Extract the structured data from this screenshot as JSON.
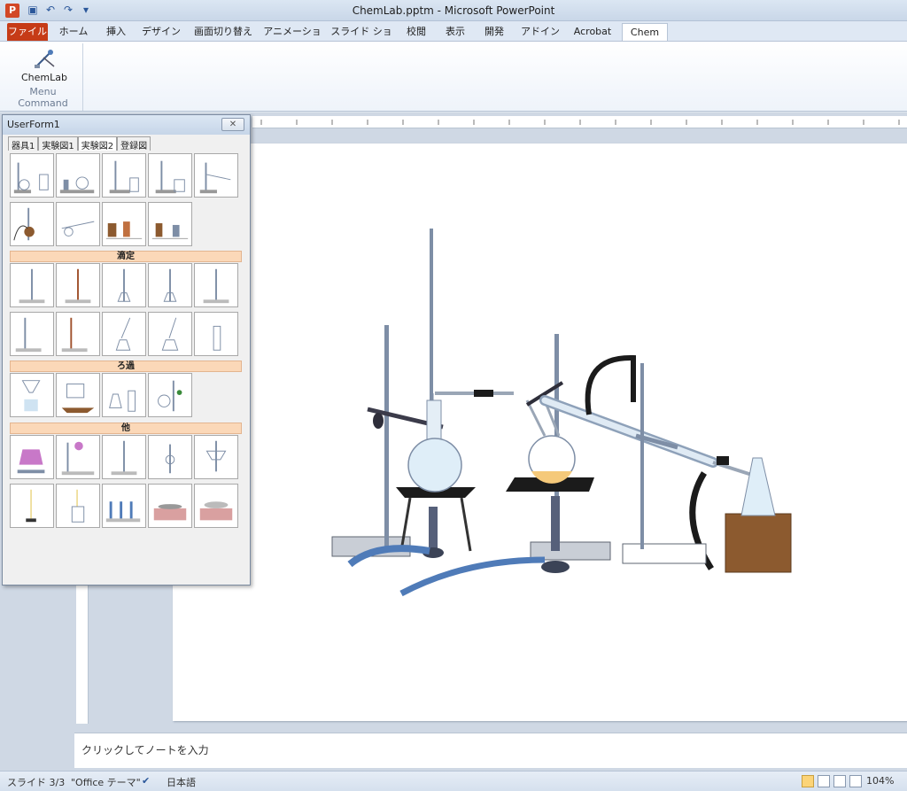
{
  "window": {
    "title": "ChemLab.pptm - Microsoft PowerPoint",
    "app_icon": "P"
  },
  "ribbon": {
    "tabs": [
      "ファイル",
      "ホーム",
      "挿入",
      "デザイン",
      "画面切り替え",
      "アニメーション",
      "スライド ショー",
      "校閲",
      "表示",
      "開発",
      "アドイン",
      "Acrobat",
      "Chem"
    ],
    "active_tab": "Chem",
    "group": {
      "button_label": "ChemLab",
      "group_label": "Menu Command"
    }
  },
  "userform": {
    "title": "UserForm1",
    "close": "✕",
    "tabs": [
      "器具1",
      "実験図1",
      "実験図2",
      "登録図"
    ],
    "active_tab": "実験図2",
    "sections": [
      "滴定",
      "ろ過",
      "他"
    ]
  },
  "notes": {
    "placeholder": "クリックしてノートを入力"
  },
  "statusbar": {
    "slide": "スライド 3/3",
    "theme": "\"Office テーマ\"",
    "language": "日本語",
    "zoom": "104%"
  },
  "colors": {
    "file_tab": "#c63b17",
    "section_bar": "#fbd8b8",
    "stand": "#7e8ea6",
    "glass": "#c7dfee",
    "tube_black": "#1b1b1b",
    "tube_blue": "#4f7bb8",
    "wood": "#8c5a2f"
  }
}
